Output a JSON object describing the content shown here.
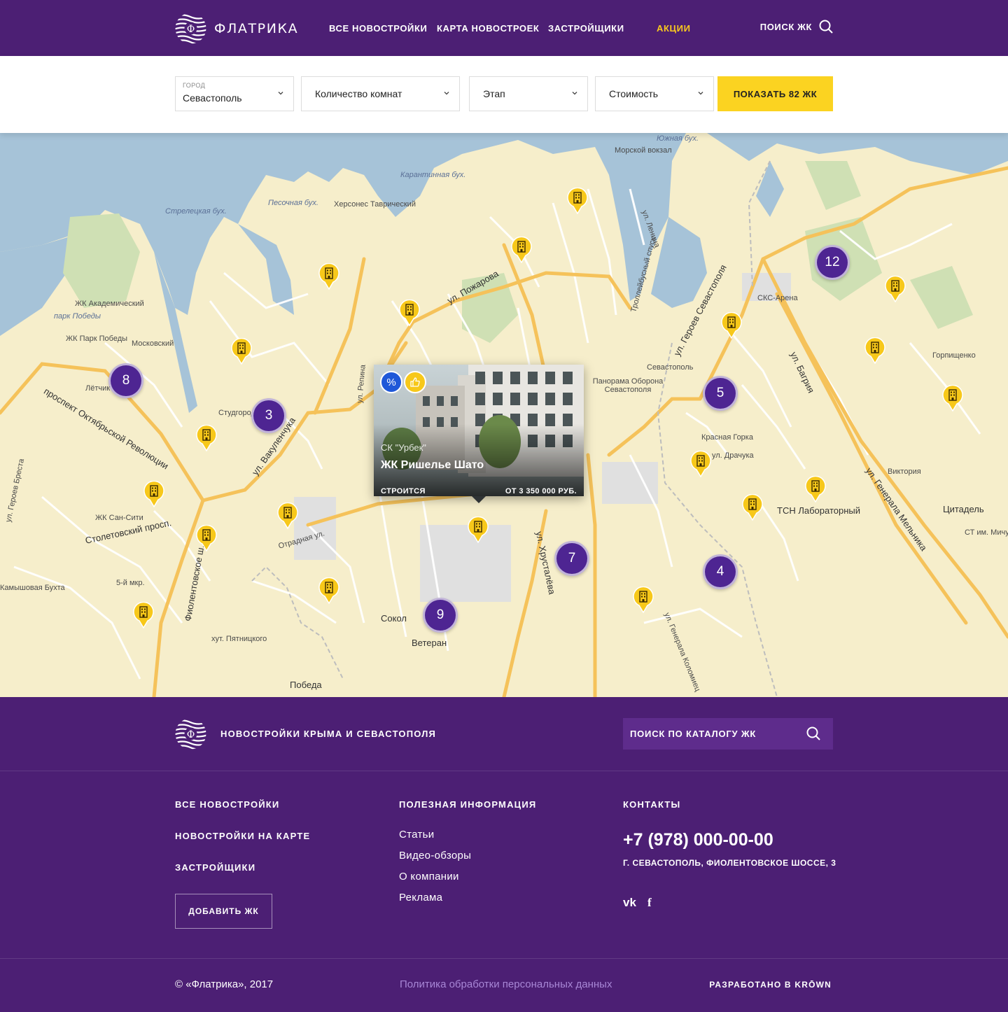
{
  "header": {
    "logo_text": "ФЛАТРИКА",
    "nav": [
      {
        "label": "ВСЕ НОВОСТРОЙКИ"
      },
      {
        "label": "КАРТА НОВОСТРОЕК"
      },
      {
        "label": "ЗАСТРОЙЩИКИ"
      },
      {
        "label": "АКЦИИ"
      }
    ],
    "search_label": "ПОИСК ЖК",
    "promo_color": "#f9c81e",
    "bg_color": "#4c1f74"
  },
  "filters": {
    "city": {
      "label": "ГОРОД",
      "value": "Севастополь"
    },
    "rooms": {
      "value": "Количество комнат"
    },
    "stage": {
      "value": "Этап"
    },
    "price": {
      "value": "Стоимость"
    },
    "show_button": "ПОКАЗАТЬ 82 ЖК",
    "button_color": "#fbd321"
  },
  "map": {
    "clusters": [
      "8",
      "3",
      "12",
      "5",
      "7",
      "4",
      "9"
    ],
    "labels": [
      "Южная бух.",
      "Морской вокзал",
      "Карантинная бух.",
      "Херсонес Таврический",
      "Песочная бух.",
      "Стрелецкая бух.",
      "ЖК Академический",
      "парк Победы",
      "ЖК Парк Победы",
      "Московский",
      "Лётчик",
      "Студгородок",
      "проспект Октябрьской Революции",
      "ул. Вакуленчука",
      "ул. Пожарова",
      "СКС-Арена",
      "ул. Героев Севастополя",
      "Панорама Оборона Севастополя",
      "Севастополь",
      "Красная Горка",
      "ул. Драчука",
      "ТСН Лабораторный",
      "Цитадель",
      "Виктория",
      "Горпищенко",
      "ЖК Сан-Сити",
      "Столетовский просп.",
      "5-й мкр.",
      "Камышовая Бухта",
      "Отрадная ул.",
      "Сокол",
      "Ветеран",
      "Победа",
      "хут. Пятницкого",
      "ул. Хрусталёва",
      "ул. Генерала Мельника",
      "Троллейбусный спуск",
      "ул. Репина",
      "ул. Ленина",
      "ул. Багрия",
      "ул. Генерала Коломиец",
      "Фиолентовское ш.",
      "ул. Героев Бреста",
      "СТ им. Мичурина"
    ],
    "popup": {
      "developer": "СК \"Урбек\"",
      "name": "ЖК Ришелье Шато",
      "status": "СТРОИТСЯ",
      "price": "ОТ 3 350 000 РУБ.",
      "badge_discount": "%",
      "badge_like_icon": "thumbs-up-icon"
    },
    "pin_color": "#f7c81a",
    "cluster_color": "#4e2592"
  },
  "footer": {
    "tagline": "НОВОСТРОЙКИ КРЫМА И СЕВАСТОПОЛЯ",
    "search_placeholder": "ПОИСК ПО КАТАЛОГУ ЖК",
    "col1": [
      "ВСЕ НОВОСТРОЙКИ",
      "НОВОСТРОЙКИ НА КАРТЕ",
      "ЗАСТРОЙЩИКИ"
    ],
    "add_button": "ДОБАВИТЬ ЖК",
    "col2_title": "ПОЛЕЗНАЯ ИНФОРМАЦИЯ",
    "col2": [
      "Статьи",
      "Видео-обзоры",
      "О компании",
      "Реклама"
    ],
    "col3_title": "КОНТАКТЫ",
    "phone": "+7 (978) 000-00-00",
    "address": "Г. СЕВАСТОПОЛЬ, ФИОЛЕНТОВСКОЕ ШОССЕ, 3",
    "social": [
      "vk-icon",
      "facebook-icon"
    ],
    "social_text": [
      "vk",
      "f"
    ],
    "copyright": "© «Флатрика», 2017",
    "policy": "Политика обработки персональных данных",
    "credit": "РАЗРАБОТАНО В KRŌWN"
  }
}
